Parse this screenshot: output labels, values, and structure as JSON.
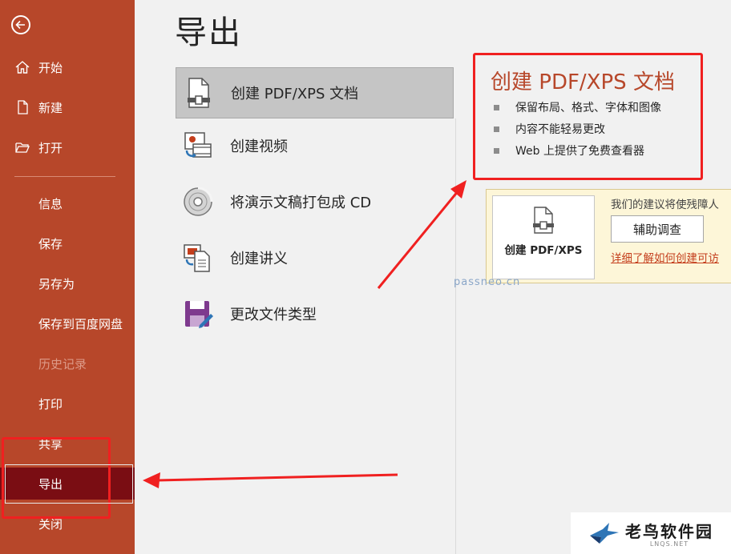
{
  "sidebar": {
    "items": [
      {
        "label": "开始",
        "icon": "home-icon"
      },
      {
        "label": "新建",
        "icon": "new-document-icon"
      },
      {
        "label": "打开",
        "icon": "folder-open-icon"
      },
      {
        "label": "信息"
      },
      {
        "label": "保存"
      },
      {
        "label": "另存为"
      },
      {
        "label": "保存到百度网盘"
      },
      {
        "label": "历史记录",
        "state": "disabled"
      },
      {
        "label": "打印"
      },
      {
        "label": "共享"
      },
      {
        "label": "导出",
        "state": "selected"
      },
      {
        "label": "关闭"
      }
    ]
  },
  "main": {
    "title": "导出",
    "options": [
      {
        "label": "创建 PDF/XPS 文档",
        "icon": "pdf-document-icon",
        "selected": true
      },
      {
        "label": "创建视频",
        "icon": "video-icon"
      },
      {
        "label": "将演示文稿打包成 CD",
        "icon": "cd-icon"
      },
      {
        "label": "创建讲义",
        "icon": "handout-icon"
      },
      {
        "label": "更改文件类型",
        "icon": "file-type-icon"
      }
    ],
    "detail": {
      "title": "创建 PDF/XPS 文档",
      "bullets": [
        "保留布局、格式、字体和图像",
        "内容不能轻易更改",
        "Web 上提供了免费查看器"
      ],
      "create_button_label": "创建 PDF/XPS",
      "accessibility_text": "我们的建议将使残障人",
      "survey_button_label": "辅助调查",
      "learn_more_link": "详细了解如何创建可访"
    }
  },
  "watermark": "passneo.cn",
  "logo": {
    "name": "老鸟软件园",
    "sub": "LNQS.NET"
  },
  "colors": {
    "sidebar_bg": "#b7472a",
    "selected_bg": "#7a0d13",
    "accent": "#b7472a",
    "annotation": "#f02020"
  }
}
